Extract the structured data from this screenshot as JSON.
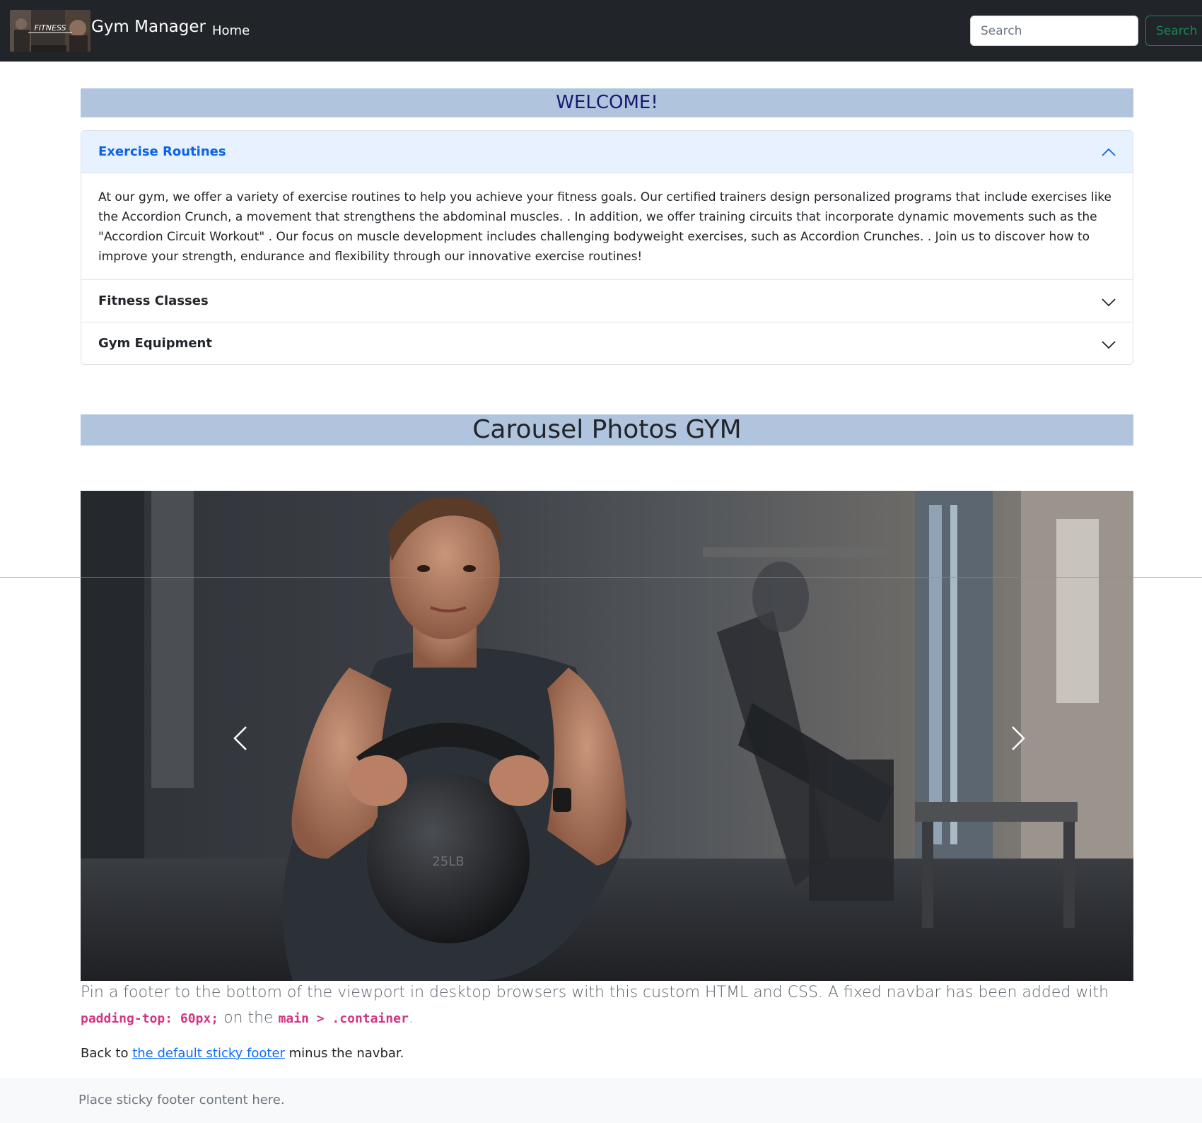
{
  "navbar": {
    "brand_name": "Gym Manager",
    "logo_text": "FITNESS",
    "home_label": "Home",
    "search_placeholder": "Search",
    "search_button_label": "Search"
  },
  "welcome": {
    "title": "WELCOME!"
  },
  "accordion": {
    "items": [
      {
        "title": "Exercise Routines",
        "expanded": true,
        "body": "At our gym, we offer a variety of exercise routines to help you achieve your fitness goals. Our certified trainers design personalized programs that include exercises like the Accordion Crunch, a movement that strengthens the abdominal muscles. . In addition, we offer training circuits that incorporate dynamic movements such as the \"Accordion Circuit Workout\" . Our focus on muscle development includes challenging bodyweight exercises, such as Accordion Crunches. . Join us to discover how to improve your strength, endurance and flexibility through our innovative exercise routines!"
      },
      {
        "title": "Fitness Classes",
        "expanded": false
      },
      {
        "title": "Gym Equipment",
        "expanded": false
      }
    ]
  },
  "carousel": {
    "heading": "Carousel Photos GYM",
    "kettlebell_text": "25LB"
  },
  "lead": {
    "text_1": "Pin a footer to the bottom of the viewport in desktop browsers with this custom HTML and CSS. A fixed navbar has been added with ",
    "code_1": "padding-top: 60px;",
    "text_2": " on the ",
    "code_2": "main > .container",
    "text_3": "."
  },
  "backlink": {
    "prefix": "Back to ",
    "link_text": "the default sticky footer",
    "suffix": " minus the navbar."
  },
  "footer": {
    "text": "Place sticky footer content here."
  },
  "colors": {
    "navbar_bg": "#212529",
    "banner_bg": "#b0c4de",
    "welcome_text": "#191970",
    "accordion_active_bg": "#e7f1ff",
    "accordion_active_text": "#0c63e4",
    "search_button": "#198754",
    "code_text": "#d63384",
    "link": "#0d6efd",
    "footer_bg": "#f8f9fa"
  },
  "icons": [
    "chevron-up-icon",
    "chevron-down-icon",
    "chevron-left-icon",
    "chevron-right-icon"
  ]
}
